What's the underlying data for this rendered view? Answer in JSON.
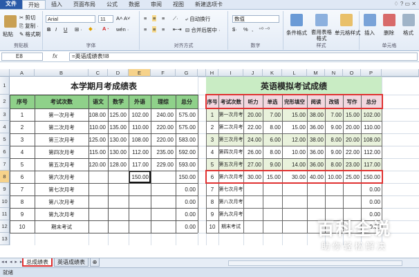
{
  "ribbon_tabs": [
    "文件",
    "开始",
    "插入",
    "页面布局",
    "公式",
    "数据",
    "审阅",
    "视图",
    "新建选项卡"
  ],
  "ribbon": {
    "clipboard": {
      "label": "剪贴板",
      "paste": "粘贴",
      "cut": "剪切",
      "copy": "复制 ·",
      "format_painter": "格式刷"
    },
    "font": {
      "label": "字体",
      "name": "Arial",
      "size": "11",
      "bold": "B",
      "italic": "I",
      "underline": "U"
    },
    "alignment": {
      "label": "对齐方式",
      "wrap": "自动换行",
      "merge": "合并后居中 ·"
    },
    "number": {
      "label": "数字",
      "format": "数值",
      "percent": "%",
      "comma": ","
    },
    "styles": {
      "label": "样式",
      "conditional": "条件格式",
      "table": "套用表格格式",
      "cell_styles": "单元格样式"
    },
    "cells": {
      "label": "单元格",
      "insert": "插入",
      "delete": "删除",
      "format": "格式"
    }
  },
  "formula_bar": {
    "name_box": "E8",
    "fx": "fx",
    "formula": "=英语成绩表!I8"
  },
  "columns_left": [
    "A",
    "B",
    "C",
    "D",
    "E",
    "F",
    "G"
  ],
  "columns_right": [
    "H",
    "I",
    "J",
    "K",
    "L",
    "M",
    "N",
    "O",
    "P"
  ],
  "row_numbers": [
    "1",
    "2",
    "3",
    "4",
    "5",
    "6",
    "7",
    "8",
    "9",
    "10",
    "11",
    "12",
    "13"
  ],
  "left_table": {
    "title": "本学期月考成绩表",
    "headers": [
      "序号",
      "考试次数",
      "语文",
      "数学",
      "外语",
      "理综",
      "总分"
    ],
    "rows": [
      [
        "1",
        "第一次月考",
        "108.00",
        "125.00",
        "102.00",
        "240.00",
        "575.00"
      ],
      [
        "2",
        "第二次月考",
        "110.00",
        "135.00",
        "110.00",
        "220.00",
        "575.00"
      ],
      [
        "3",
        "第三次月考",
        "125.00",
        "130.00",
        "108.00",
        "220.00",
        "583.00"
      ],
      [
        "4",
        "第四次月考",
        "115.00",
        "130.00",
        "112.00",
        "235.00",
        "592.00"
      ],
      [
        "5",
        "第五次月考",
        "120.00",
        "128.00",
        "117.00",
        "229.00",
        "593.00"
      ],
      [
        "6",
        "第六次月考",
        "",
        "",
        "150.00",
        "",
        "150.00"
      ],
      [
        "7",
        "第七次月考",
        "",
        "",
        "",
        "",
        "0.00"
      ],
      [
        "8",
        "第八次月考",
        "",
        "",
        "",
        "",
        "0.00"
      ],
      [
        "9",
        "第九次月考",
        "",
        "",
        "",
        "",
        "0.00"
      ],
      [
        "10",
        "期末考试",
        "",
        "",
        "",
        "",
        "0.00"
      ]
    ]
  },
  "right_table": {
    "title": "英语模拟考试成绩",
    "headers": [
      "序号",
      "考试次数",
      "听力",
      "单选",
      "完形填空",
      "阅读",
      "改错",
      "写作",
      "总分"
    ],
    "rows": [
      [
        "1",
        "第一次月考",
        "20.00",
        "7.00",
        "15.00",
        "38.00",
        "7.00",
        "15.00",
        "102.00"
      ],
      [
        "2",
        "第二次月考",
        "22.00",
        "8.00",
        "15.00",
        "36.00",
        "9.00",
        "20.00",
        "110.00"
      ],
      [
        "3",
        "第三次月考",
        "24.00",
        "6.00",
        "12.00",
        "38.00",
        "8.00",
        "20.00",
        "108.00"
      ],
      [
        "4",
        "第四次月考",
        "26.00",
        "8.00",
        "10.00",
        "36.00",
        "9.00",
        "22.00",
        "112.00"
      ],
      [
        "5",
        "第五次月考",
        "27.00",
        "9.00",
        "14.00",
        "36.00",
        "8.00",
        "23.00",
        "117.00"
      ],
      [
        "6",
        "第六次月考",
        "30.00",
        "15.00",
        "30.00",
        "40.00",
        "10.00",
        "25.00",
        "150.00"
      ],
      [
        "7",
        "第七次月考",
        "",
        "",
        "",
        "",
        "",
        "",
        "0.00"
      ],
      [
        "8",
        "第八次月考",
        "",
        "",
        "",
        "",
        "",
        "",
        "0.00"
      ],
      [
        "9",
        "第九次月考",
        "",
        "",
        "",
        "",
        "",
        "",
        "0.00"
      ],
      [
        "10",
        "期末考试",
        "",
        "",
        "",
        "",
        "",
        "",
        "0.00"
      ]
    ]
  },
  "sheets": [
    "总成绩表",
    "英语成绩表"
  ],
  "status": "就绪",
  "watermark": {
    "title": "百科全说",
    "subtitle": "助你轻松解决"
  },
  "colors": {
    "header_green": "#8fd18a",
    "title_green": "#c9ecc4",
    "red_highlight": "#e03030",
    "header_pink": "#f2d7df",
    "row_green": "#e9f2dc"
  }
}
